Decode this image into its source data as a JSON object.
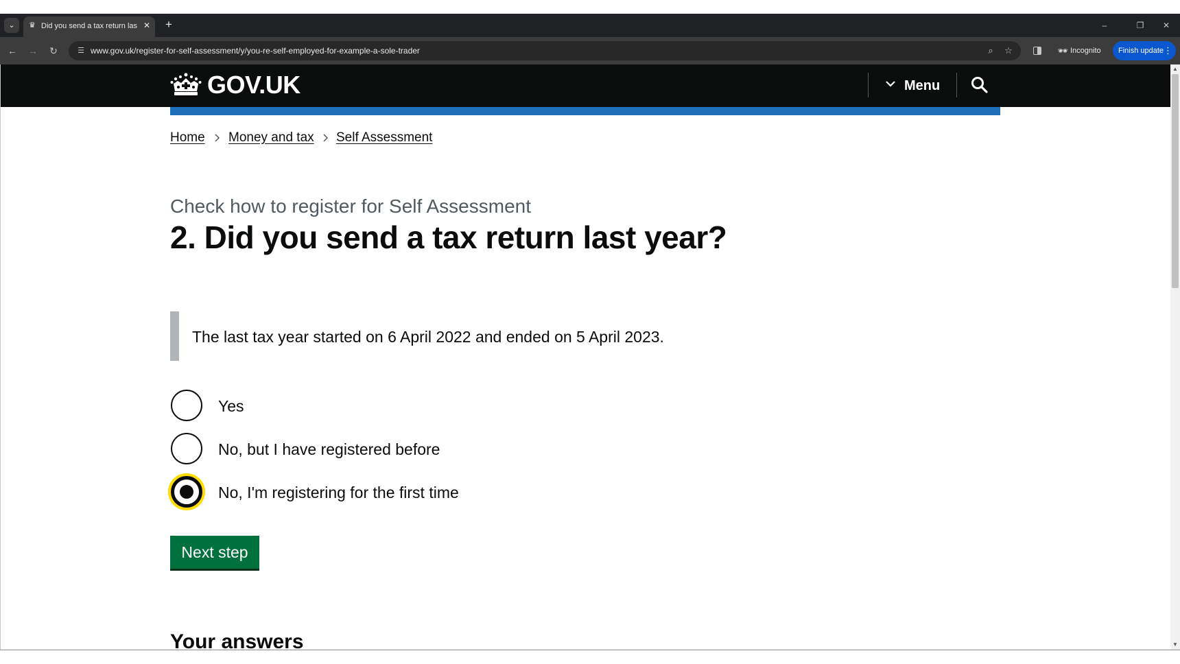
{
  "browser": {
    "tab": {
      "title": "Did you send a tax return last year?"
    },
    "address_bar": {
      "url": "www.gov.uk/register-for-self-assessment/y/you-re-self-employed-for-example-a-sole-trader"
    },
    "incognito_label": "Incognito",
    "update_button_label": "Finish update",
    "icons": {
      "tab_list": "chevron-down-icon",
      "close_tab": "close-icon",
      "new_tab": "plus-icon",
      "back": "back-arrow-icon",
      "forward": "forward-arrow-icon",
      "reload": "reload-icon",
      "site_info": "tune-icon",
      "zoom": "zoom-icon",
      "bookmark": "star-icon",
      "side_panel": "side-panel-icon",
      "incognito": "incognito-icon",
      "more": "kebab-icon",
      "minimize": "minimize-icon",
      "restore": "restore-icon",
      "close_window": "close-icon"
    }
  },
  "header": {
    "logo_text": "GOV.UK",
    "menu_label": "Menu",
    "brand_color": "#1d70b8",
    "background_color": "#0b0c0c"
  },
  "breadcrumbs": [
    {
      "label": "Home"
    },
    {
      "label": "Money and tax"
    },
    {
      "label": "Self Assessment"
    }
  ],
  "main": {
    "caption": "Check how to register for Self Assessment",
    "heading": "2. Did you send a tax return last year?",
    "inset_text": "The last tax year started on 6 April 2022 and ended on 5 April 2023.",
    "options": [
      {
        "label": "Yes",
        "selected": false
      },
      {
        "label": "No, but I have registered before",
        "selected": false
      },
      {
        "label": "No, I'm registering for the first time",
        "selected": true
      }
    ],
    "focus_color": "#ffdd00",
    "next_button_label": "Next step",
    "next_button_color": "#00703c",
    "answers_heading": "Your answers"
  }
}
